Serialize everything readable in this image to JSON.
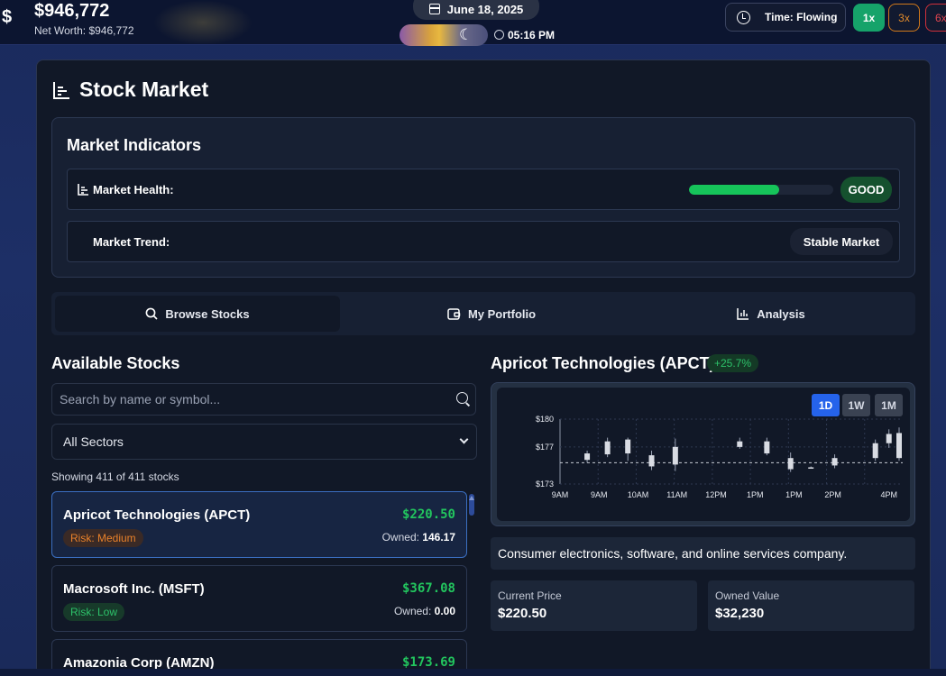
{
  "header": {
    "net_worth_big": "$946,772",
    "net_worth_label": "Net Worth: $946,772",
    "date": "June 18, 2025",
    "time": "05:16 PM",
    "time_mode": "Time: Flowing",
    "speeds": [
      "1x",
      "3x",
      "6x"
    ],
    "active_speed": "1x"
  },
  "page": {
    "title": "Stock Market"
  },
  "indicators": {
    "title": "Market Indicators",
    "health_label": "Market Health:",
    "health_fraction": 0.625,
    "health_status": "GOOD",
    "trend_label": "Market Trend:",
    "trend_status": "Stable Market"
  },
  "tabs": [
    {
      "label": "Browse Stocks",
      "icon": "search-icon",
      "active": true
    },
    {
      "label": "My Portfolio",
      "icon": "wallet-icon",
      "active": false
    },
    {
      "label": "Analysis",
      "icon": "bar-chart-icon",
      "active": false
    }
  ],
  "stocks": {
    "title": "Available Stocks",
    "search_placeholder": "Search by name or symbol...",
    "sector_selected": "All Sectors",
    "showing": "Showing 411 of 411 stocks",
    "owned_prefix": "Owned:",
    "items": [
      {
        "name": "Apricot Technologies (APCT)",
        "price": "$220.50",
        "risk": "Risk: Medium",
        "owned": "146.17",
        "selected": true
      },
      {
        "name": "Macrosoft Inc. (MSFT)",
        "price": "$367.08",
        "risk": "Risk: Low",
        "owned": "0.00",
        "selected": false
      },
      {
        "name": "Amazonia Corp (AMZN)",
        "price": "$173.69",
        "risk": "",
        "owned": "",
        "selected": false
      }
    ]
  },
  "detail": {
    "title": "Apricot Technologies (APCT)",
    "change": "+25.7%",
    "ranges": [
      "1D",
      "1W",
      "1M"
    ],
    "active_range": "1D",
    "description": "Consumer electronics, software, and online services company.",
    "current_price_label": "Current Price",
    "current_price": "$220.50",
    "owned_value_label": "Owned Value",
    "owned_value": "$32,230"
  },
  "colors": {
    "accent_green": "#22c55e",
    "accent_blue": "#2563eb",
    "risk_medium": "#e8812a",
    "risk_low": "#2dc26a"
  },
  "chart_data": {
    "type": "candlestick",
    "y_ticks": [
      "$180",
      "$177",
      "$173"
    ],
    "ylim": [
      173,
      180
    ],
    "x_ticks": [
      "9AM",
      "9AM",
      "10AM",
      "11AM",
      "12PM",
      "1PM",
      "1PM",
      "2PM",
      "4PM"
    ],
    "reference_line": 175.3,
    "candles": [
      {
        "t": 0.08,
        "open": 175.6,
        "close": 176.3,
        "high": 176.6,
        "low": 175.3
      },
      {
        "t": 0.14,
        "open": 176.2,
        "close": 177.6,
        "high": 178.0,
        "low": 175.9
      },
      {
        "t": 0.2,
        "open": 176.3,
        "close": 177.8,
        "high": 178.0,
        "low": 175.5
      },
      {
        "t": 0.27,
        "open": 176.1,
        "close": 174.9,
        "high": 176.6,
        "low": 174.5
      },
      {
        "t": 0.34,
        "open": 177.0,
        "close": 175.1,
        "high": 177.9,
        "low": 174.4
      },
      {
        "t": 0.53,
        "open": 177.0,
        "close": 177.6,
        "high": 178.0,
        "low": 176.8
      },
      {
        "t": 0.61,
        "open": 176.3,
        "close": 177.6,
        "high": 178.0,
        "low": 176.1
      },
      {
        "t": 0.68,
        "open": 175.8,
        "close": 174.6,
        "high": 176.4,
        "low": 174.3
      },
      {
        "t": 0.74,
        "open": 174.8,
        "close": 174.8,
        "high": 174.9,
        "low": 174.7
      },
      {
        "t": 0.81,
        "open": 175.8,
        "close": 175.0,
        "high": 176.2,
        "low": 174.7
      },
      {
        "t": 0.93,
        "open": 175.8,
        "close": 177.4,
        "high": 177.8,
        "low": 175.5
      },
      {
        "t": 0.97,
        "open": 177.4,
        "close": 178.4,
        "high": 178.9,
        "low": 176.9
      },
      {
        "t": 1.0,
        "open": 175.8,
        "close": 178.5,
        "high": 179.1,
        "low": 175.5
      }
    ]
  }
}
